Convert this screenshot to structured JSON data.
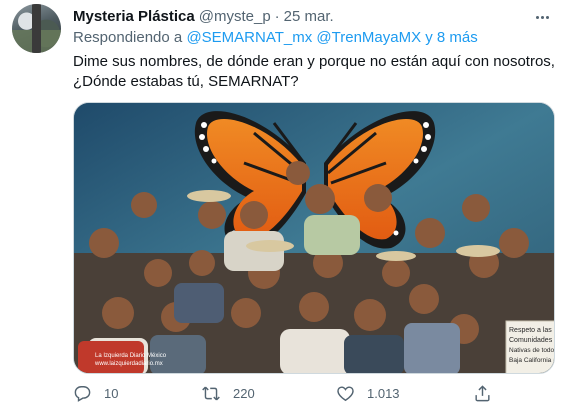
{
  "tweet": {
    "author_name": "Mysteria Plástica",
    "handle": "@myste_p",
    "separator": "·",
    "date": "25 mar.",
    "reply_prefix": "Respondiendo a",
    "reply_mentions": "@SEMARNAT_mx @TrenMayaMX y 8 más",
    "text_line1": "Dime sus nombres, de dónde eran y porque no están aquí con nosotros,",
    "text_line2": "¿Dónde estabas tú, SEMARNAT?",
    "media": {
      "watermark_line1": "La Izquierda Diario México",
      "watermark_line2": "www.laizquierdadiario.mx",
      "sign_text_line1": "Respeto a las",
      "sign_text_line2": "Comunidades",
      "sign_text_line3": "Nativas de todo",
      "sign_text_line4": "Baja California"
    },
    "actions": {
      "reply_count": "10",
      "retweet_count": "220",
      "like_count": "1.013"
    },
    "colors": {
      "link": "#1d9bf0",
      "secondary_text": "#536471",
      "primary_text": "#0f1419"
    },
    "icons": {
      "more": "more-dots-icon",
      "reply": "reply-icon",
      "retweet": "retweet-icon",
      "like": "heart-icon",
      "share": "share-icon"
    }
  }
}
